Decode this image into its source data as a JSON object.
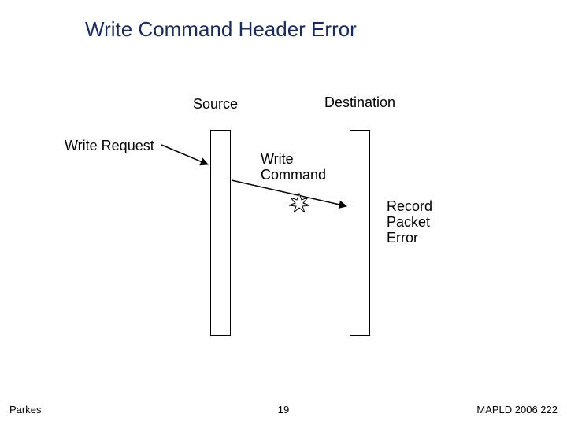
{
  "title": "Write Command Header Error",
  "labels": {
    "source": "Source",
    "destination": "Destination",
    "write_request": "Write Request",
    "write_line1": "Write",
    "write_line2": "Command",
    "record_line1": "Record",
    "record_line2": "Packet",
    "record_line3": "Error"
  },
  "footer": {
    "left": "Parkes",
    "center": "19",
    "right": "MAPLD 2006 222"
  },
  "colors": {
    "title": "#1b2c5a"
  }
}
